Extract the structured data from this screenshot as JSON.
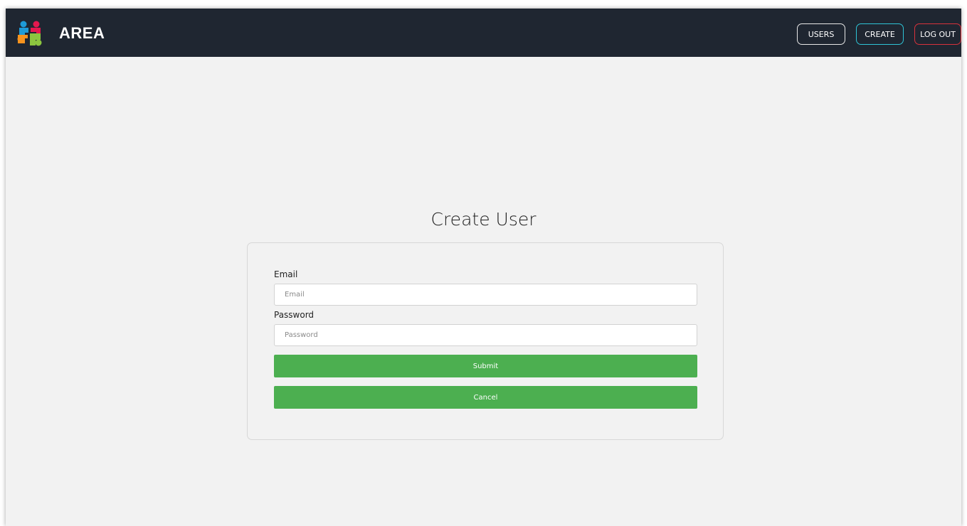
{
  "navbar": {
    "brand": "AREA",
    "logo_icon": "puzzle-people-logo-icon",
    "logo_colors": [
      "#1e9bd7",
      "#e5184f",
      "#f7931e",
      "#8cc63f"
    ],
    "users_label": "USERS",
    "create_label": "CREATE",
    "logout_label": "LOG OUT",
    "create_accent": "#2ec4d6",
    "logout_accent": "#d8323c"
  },
  "page": {
    "title": "Create User"
  },
  "form": {
    "email_label": "Email",
    "email_placeholder": "Email",
    "email_value": "",
    "password_label": "Password",
    "password_placeholder": "Password",
    "password_value": "",
    "submit_label": "Submit",
    "cancel_label": "Cancel",
    "button_color": "#4caf50"
  }
}
